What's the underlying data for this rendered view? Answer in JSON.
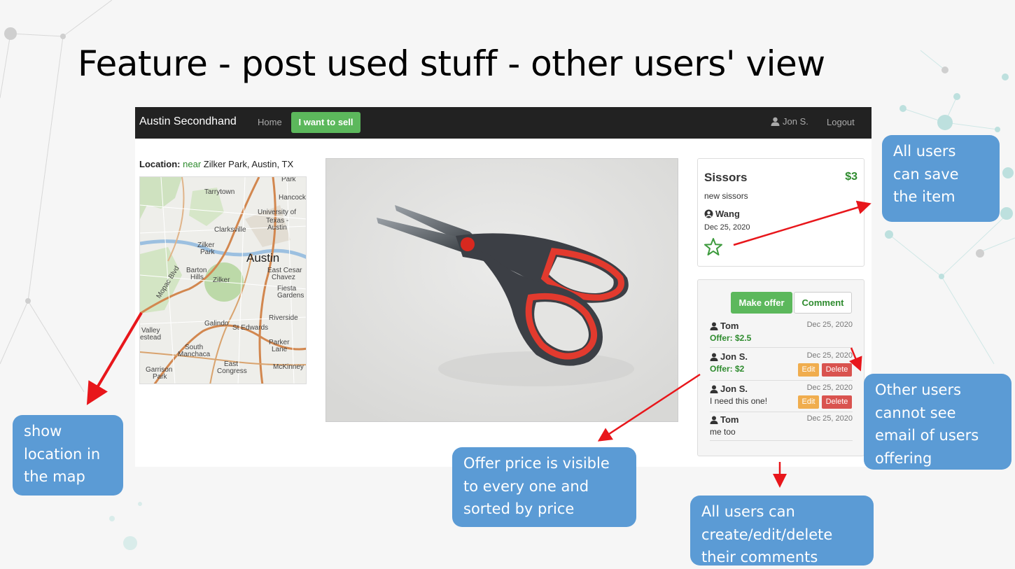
{
  "slide": {
    "title": "Feature - post used stuff - other users' view"
  },
  "navbar": {
    "brand": "Austin Secondhand",
    "home": "Home",
    "sell_button": "I want to sell",
    "user": "Jon S.",
    "logout": "Logout"
  },
  "location": {
    "label": "Location:",
    "near": "near",
    "place": "Zilker Park, Austin, TX"
  },
  "map": {
    "labels": [
      "Tarrytown",
      "Park",
      "Hancock",
      "University of",
      "Texas -",
      "Austin",
      "Clarksville",
      "Zilker",
      "Park",
      "Austin",
      "Barton",
      "Hills",
      "Zilker",
      "East Cesar",
      "Chavez",
      "Fiesta",
      "Gardens",
      "Mopac Blvd",
      "Riverside",
      "Galindo",
      "St Edwards",
      "Valley",
      "estead",
      "South",
      "Manchaca",
      "Parker",
      "Lane",
      "East",
      "Congress",
      "McKinney",
      "Garrison",
      "Park"
    ],
    "shields": [
      "1",
      "1",
      "343",
      "290",
      "35"
    ]
  },
  "item": {
    "title": "Sissors",
    "price": "$3",
    "description": "new sissors",
    "seller": "Wang",
    "date": "Dec 25, 2020"
  },
  "actions": {
    "make_offer": "Make offer",
    "comment": "Comment",
    "edit": "Edit",
    "delete": "Delete"
  },
  "comments": [
    {
      "user": "Tom",
      "date": "Dec 25, 2020",
      "offer": "Offer: $2.5"
    },
    {
      "user": "Jon S.",
      "date": "Dec 25, 2020",
      "offer": "Offer: $2"
    },
    {
      "user": "Jon S.",
      "date": "Dec 25, 2020",
      "text": "I need this one!"
    },
    {
      "user": "Tom",
      "date": "Dec 25, 2020",
      "text": "me too"
    }
  ],
  "callouts": {
    "save": "All users\ncan save\nthe item",
    "map": "show\nlocation in\nthe map",
    "offer_price": "Offer price is visible\nto every one and\nsorted by price",
    "email": "Other users\ncannot see\nemail of users\noffering",
    "comments": "All users can\ncreate/edit/delete\ntheir comments"
  },
  "colors": {
    "navbar": "#222222",
    "success": "#5cb85c",
    "warning": "#f0ad4e",
    "danger": "#d9534f",
    "callout": "#5b9bd5",
    "arrow": "#e8161b"
  }
}
